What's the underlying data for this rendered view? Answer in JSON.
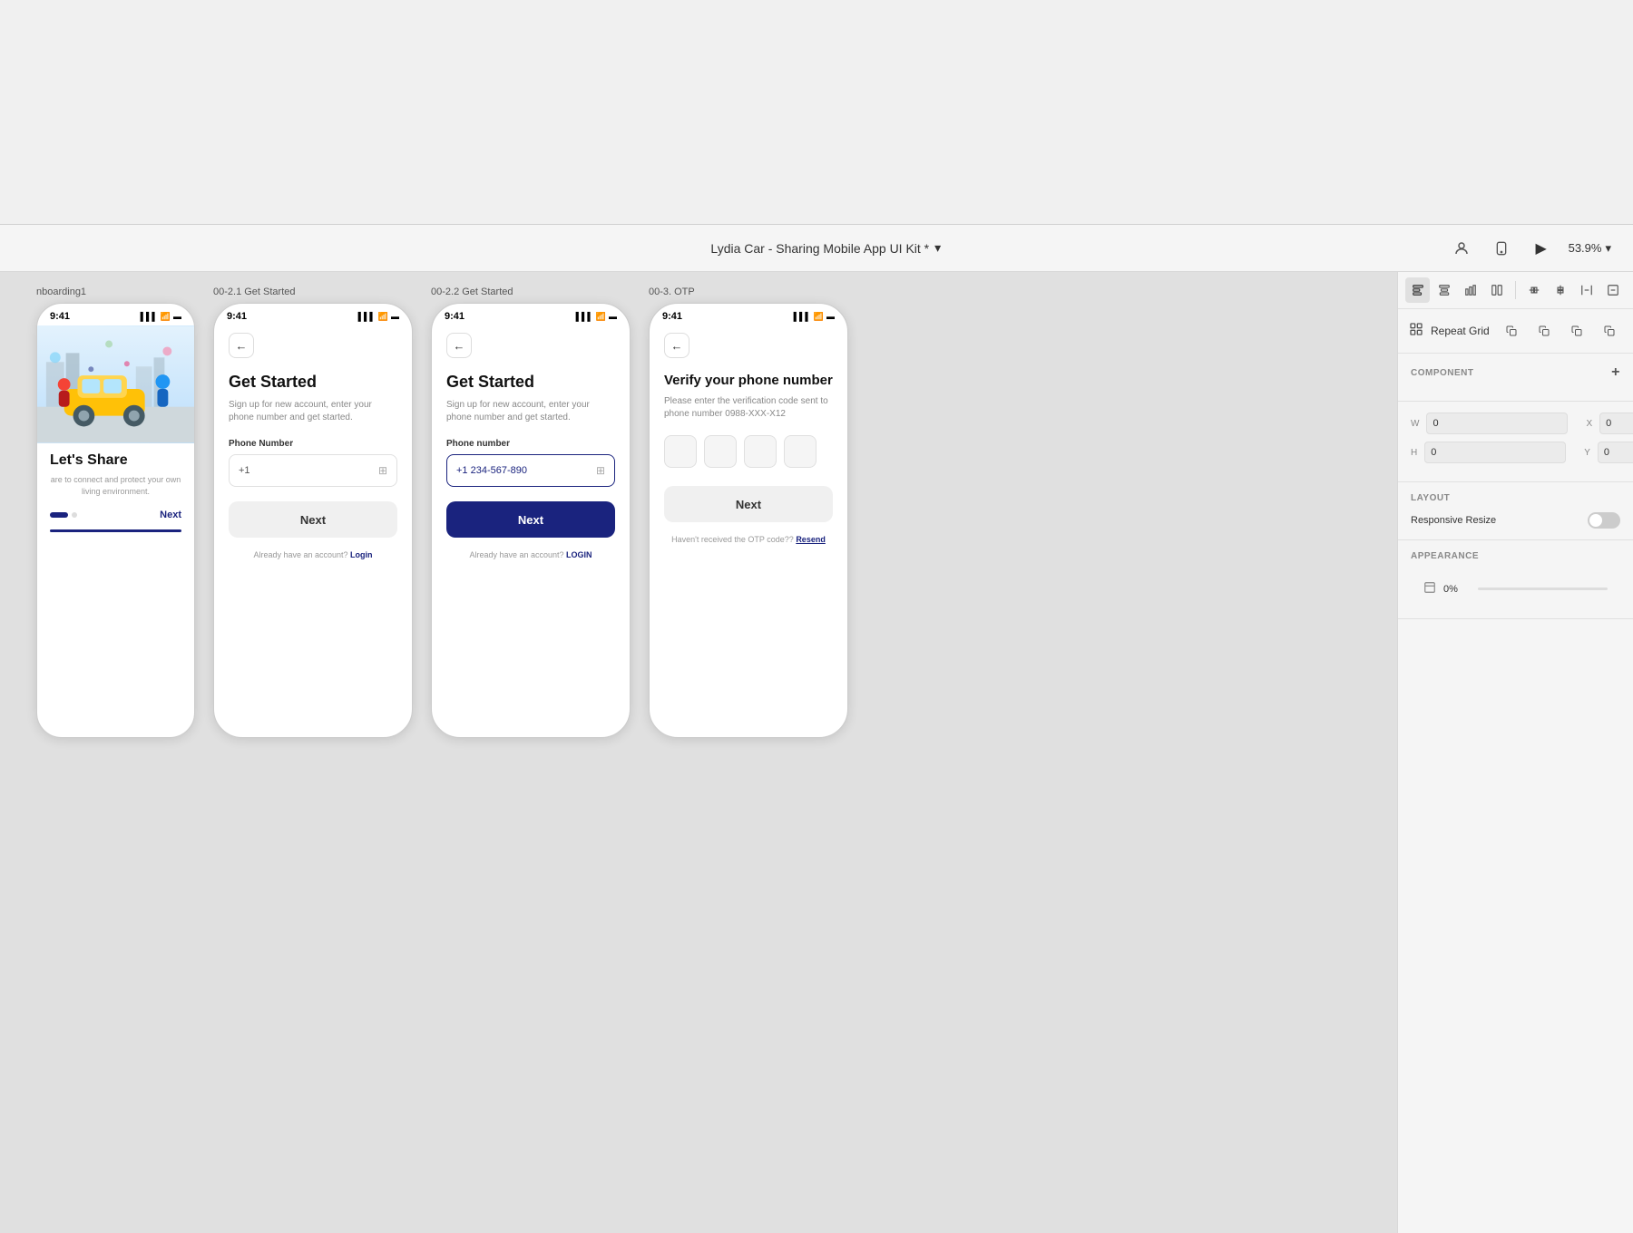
{
  "app": {
    "title": "Lydia Car - Sharing Mobile App UI Kit *",
    "zoom": "53.9%",
    "zoom_icon": "▾"
  },
  "toolbar_right": {
    "user_icon": "👤",
    "device_icon": "📱",
    "play_icon": "▶"
  },
  "panel": {
    "repeat_grid_label": "Repeat Grid",
    "component_label": "COMPONENT",
    "add_component": "+",
    "w_label": "W",
    "w_value": "0",
    "x_label": "X",
    "x_value": "0",
    "h_label": "H",
    "h_value": "0",
    "y_label": "Y",
    "y_value": "0",
    "layout_label": "LAYOUT",
    "responsive_label": "Responsive Resize",
    "appearance_label": "APPEARANCE",
    "appearance_pct": "0%"
  },
  "screens": {
    "onboarding": {
      "label": "nboarding1",
      "time": "9:41",
      "headline": "Let's Share",
      "subtext": "are to connect and protect your own\nliving environment.",
      "next_label": "Next",
      "progress_dot_active": true
    },
    "screen1": {
      "label": "00-2.1 Get Started",
      "time": "9:41",
      "title": "Get Started",
      "subtitle": "Sign up for new account, enter your phone number and get started.",
      "field_label": "Phone Number",
      "placeholder": "+1",
      "next_label": "Next",
      "already_text": "Already have an account?",
      "login_label": "Login"
    },
    "screen2": {
      "label": "00-2.2 Get Started",
      "time": "9:41",
      "title": "Get Started",
      "subtitle": "Sign up for new account, enter your phone number and get started.",
      "field_label": "Phone number",
      "value": "+1 234-567-890",
      "next_label": "Next",
      "already_text": "Already have an account?",
      "login_label": "LOGIN"
    },
    "screen3": {
      "label": "00-3. OTP",
      "time": "9:41",
      "title": "Verify your phone number",
      "subtitle": "Please enter the verification code sent to phone number 0988-XXX-X12",
      "next_label": "Next",
      "resend_prefix": "Haven't received the OTP code??",
      "resend_label": "Resend"
    }
  }
}
